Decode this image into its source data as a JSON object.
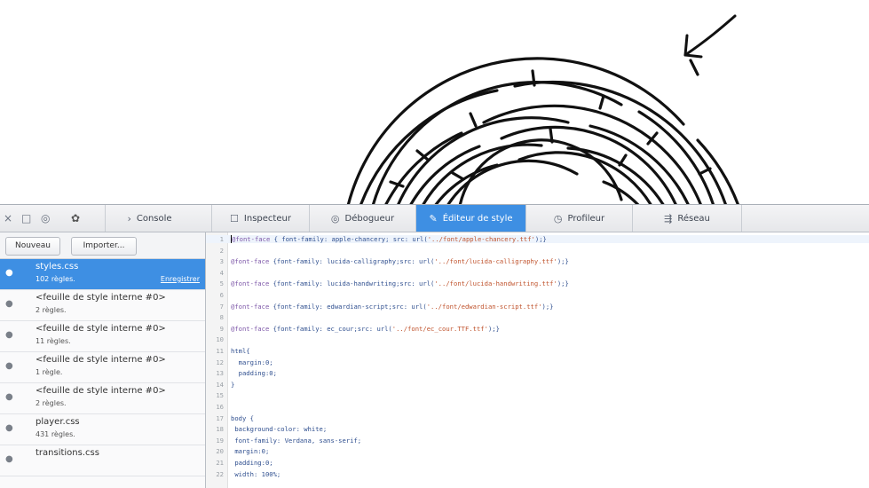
{
  "toolbar": {
    "close_icon": "×",
    "split_icon": "□",
    "responsive_icon": "◎",
    "gear_icon": "✿",
    "tabs": [
      {
        "icon": "›",
        "label": "Console"
      },
      {
        "icon": "☐",
        "label": "Inspecteur"
      },
      {
        "icon": "◎",
        "label": "Débogueur"
      },
      {
        "icon": "✎",
        "label": "Éditeur de style"
      },
      {
        "icon": "◷",
        "label": "Profileur"
      },
      {
        "icon": "⇶",
        "label": "Réseau"
      }
    ],
    "selected_tab": "Éditeur de style",
    "accent_color": "#3e8fe3"
  },
  "sidebar": {
    "new_label": "Nouveau",
    "import_label": "Importer...",
    "sheets": [
      {
        "name": "styles.css",
        "rules": "102 règles.",
        "save": "Enregistrer"
      },
      {
        "name": "<feuille de style interne #0>",
        "rules": "2 règles."
      },
      {
        "name": "<feuille de style interne #0>",
        "rules": "11 règles."
      },
      {
        "name": "<feuille de style interne #0>",
        "rules": "1 règle."
      },
      {
        "name": "<feuille de style interne #0>",
        "rules": "2 règles."
      },
      {
        "name": "player.css",
        "rules": "431 règles."
      },
      {
        "name": "transitions.css",
        "rules": ""
      }
    ]
  },
  "editor": {
    "lines": [
      {
        "n": "1",
        "text": "@font-face { font-family: apple-chancery; src: url('../font/apple-chancery.ttf');}"
      },
      {
        "n": "2",
        "text": ""
      },
      {
        "n": "3",
        "text": "@font-face {font-family: lucida-calligraphy;src: url('../font/lucida-calligraphy.ttf');}"
      },
      {
        "n": "4",
        "text": ""
      },
      {
        "n": "5",
        "text": "@font-face {font-family: lucida-handwriting;src: url('../font/lucida-handwriting.ttf');}"
      },
      {
        "n": "6",
        "text": ""
      },
      {
        "n": "7",
        "text": "@font-face {font-family: edwardian-script;src: url('../font/edwardian-script.ttf');}"
      },
      {
        "n": "8",
        "text": ""
      },
      {
        "n": "9",
        "text": "@font-face {font-family: ec_cour;src: url('../font/ec_cour.TTF.ttf');}"
      },
      {
        "n": "10",
        "text": ""
      },
      {
        "n": "11",
        "text": "html{"
      },
      {
        "n": "12",
        "text": "  margin:0;"
      },
      {
        "n": "13",
        "text": "  padding:0;"
      },
      {
        "n": "14",
        "text": "}"
      },
      {
        "n": "15",
        "text": ""
      },
      {
        "n": "16",
        "text": ""
      },
      {
        "n": "17",
        "text": "body {"
      },
      {
        "n": "18",
        "text": " background-color: white;"
      },
      {
        "n": "19",
        "text": " font-family: Verdana, sans-serif;"
      },
      {
        "n": "20",
        "text": " margin:0;"
      },
      {
        "n": "21",
        "text": " padding:0;"
      },
      {
        "n": "22",
        "text": " width: 100%;"
      }
    ]
  }
}
